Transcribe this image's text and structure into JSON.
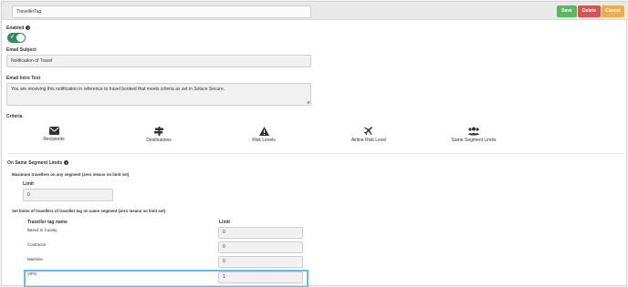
{
  "header": {
    "tag_name": "TravellerTag",
    "save_label": "Save",
    "delete_label": "Delete",
    "cancel_label": "Cancel"
  },
  "enabled": {
    "label": "Enabled",
    "info_icon": "info-circle-icon",
    "value": true
  },
  "email_subject": {
    "label": "Email Subject",
    "value": "Notification of Travel"
  },
  "email_intro": {
    "label": "Email Intro Text",
    "value": "You are receiving this notification in reference to travel booked that meets criteria as set in Solace Secure."
  },
  "criteria": {
    "label": "Criteria",
    "items": [
      {
        "label": "Recipients",
        "icon": "envelope-icon"
      },
      {
        "label": "Destinations",
        "icon": "signpost-icon"
      },
      {
        "label": "Risk Levels",
        "icon": "warning-icon"
      },
      {
        "label": "Airline Risk Level",
        "icon": "plane-icon"
      },
      {
        "label": "Same Segment Limits",
        "icon": "users-icon"
      }
    ]
  },
  "same_segment": {
    "label": "On Same Segment Limits",
    "max_label": "Maximum travellers on any segment (zero means no limit set)",
    "limit_label": "Limit",
    "limit_value": "0",
    "set_limits_label": "Set limits of travellers of traveller tag on same segment (zero means no limit set)",
    "col_name": "Traveller tag name",
    "col_limit": "Limit",
    "rows": [
      {
        "name": "Based In County",
        "limit": "0"
      },
      {
        "name": "Contractor",
        "limit": "0"
      },
      {
        "name": "Maritime",
        "limit": "0"
      },
      {
        "name": "VIPS",
        "limit": "1"
      }
    ]
  },
  "colors": {
    "save": "#5cb85c",
    "delete": "#d9534f",
    "cancel": "#f0ad4e",
    "toggle_on": "#2f8f5b",
    "highlight": "#5bc0eb"
  }
}
